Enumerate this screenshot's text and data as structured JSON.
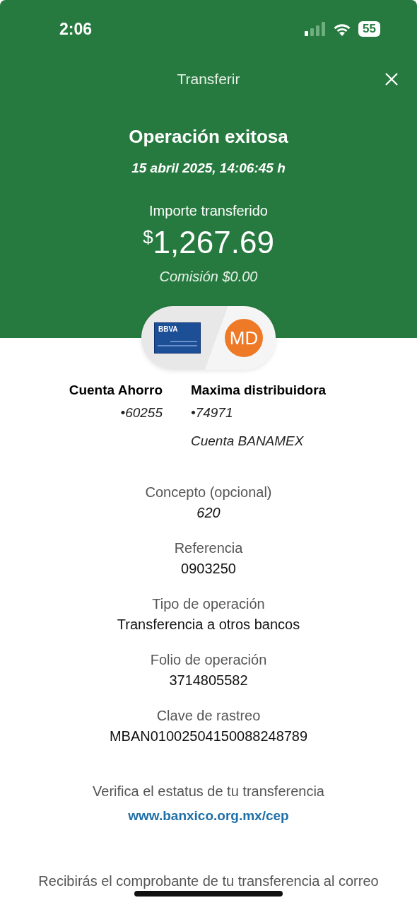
{
  "status_bar": {
    "time": "2:06",
    "battery": "55"
  },
  "header": {
    "title": "Transferir",
    "heading": "Operación exitosa",
    "date": "15 abril 2025, 14:06:45 h",
    "amount_label": "Importe transferido",
    "currency": "$",
    "amount": "1,267.69",
    "commission": "Comisión  $0.00"
  },
  "accounts": {
    "from": {
      "card_brand": "BBVA",
      "name": "Cuenta Ahorro",
      "number": "•60255"
    },
    "to": {
      "initials": "MD",
      "name": "Maxima distribuidora",
      "number": "•74971",
      "bank": "Cuenta BANAMEX"
    }
  },
  "details": [
    {
      "label": "Concepto (opcional)",
      "value": "620",
      "italic": true
    },
    {
      "label": "Referencia",
      "value": "0903250",
      "italic": false
    },
    {
      "label": "Tipo de operación",
      "value": "Transferencia a otros bancos",
      "italic": false
    },
    {
      "label": "Folio de operación",
      "value": "3714805582",
      "italic": false
    },
    {
      "label": "Clave de rastreo",
      "value": "MBAN01002504150088248789",
      "italic": false
    }
  ],
  "verify": {
    "text": "Verifica el estatus de tu transferencia",
    "link": "www.banxico.org.mx/cep"
  },
  "note": "Recibirás el comprobante de tu transferencia al correo"
}
